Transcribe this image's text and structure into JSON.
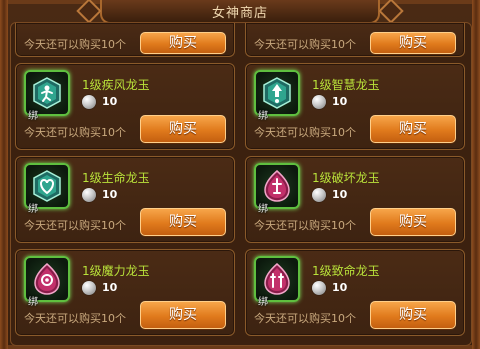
{
  "header": {
    "title": "女神商店"
  },
  "colors": {
    "accent": "#e07a1c",
    "name": "#b9e23a",
    "frame": "#8a5a2a",
    "icon_glow": "#5fbf3f"
  },
  "top_row": [
    {
      "limit": "今天还可以购买10个",
      "buy_label": "购买"
    },
    {
      "limit": "今天还可以购买10个",
      "buy_label": "购买"
    }
  ],
  "items": [
    {
      "name": "1级疾风龙玉",
      "price": "10",
      "limit": "今天还可以购买10个",
      "buy_label": "购买",
      "bind": "绑",
      "icon": "wind-jade-icon"
    },
    {
      "name": "1级智慧龙玉",
      "price": "10",
      "limit": "今天还可以购买10个",
      "buy_label": "购买",
      "bind": "绑",
      "icon": "wisdom-jade-icon"
    },
    {
      "name": "1级生命龙玉",
      "price": "10",
      "limit": "今天还可以购买10个",
      "buy_label": "购买",
      "bind": "绑",
      "icon": "life-jade-icon"
    },
    {
      "name": "1级破坏龙玉",
      "price": "10",
      "limit": "今天还可以购买10个",
      "buy_label": "购买",
      "bind": "绑",
      "icon": "destruction-jade-icon"
    },
    {
      "name": "1级魔力龙玉",
      "price": "10",
      "limit": "今天还可以购买10个",
      "buy_label": "购买",
      "bind": "绑",
      "icon": "magic-jade-icon"
    },
    {
      "name": "1级致命龙玉",
      "price": "10",
      "limit": "今天还可以购买10个",
      "buy_label": "购买",
      "bind": "绑",
      "icon": "fatal-jade-icon"
    }
  ]
}
